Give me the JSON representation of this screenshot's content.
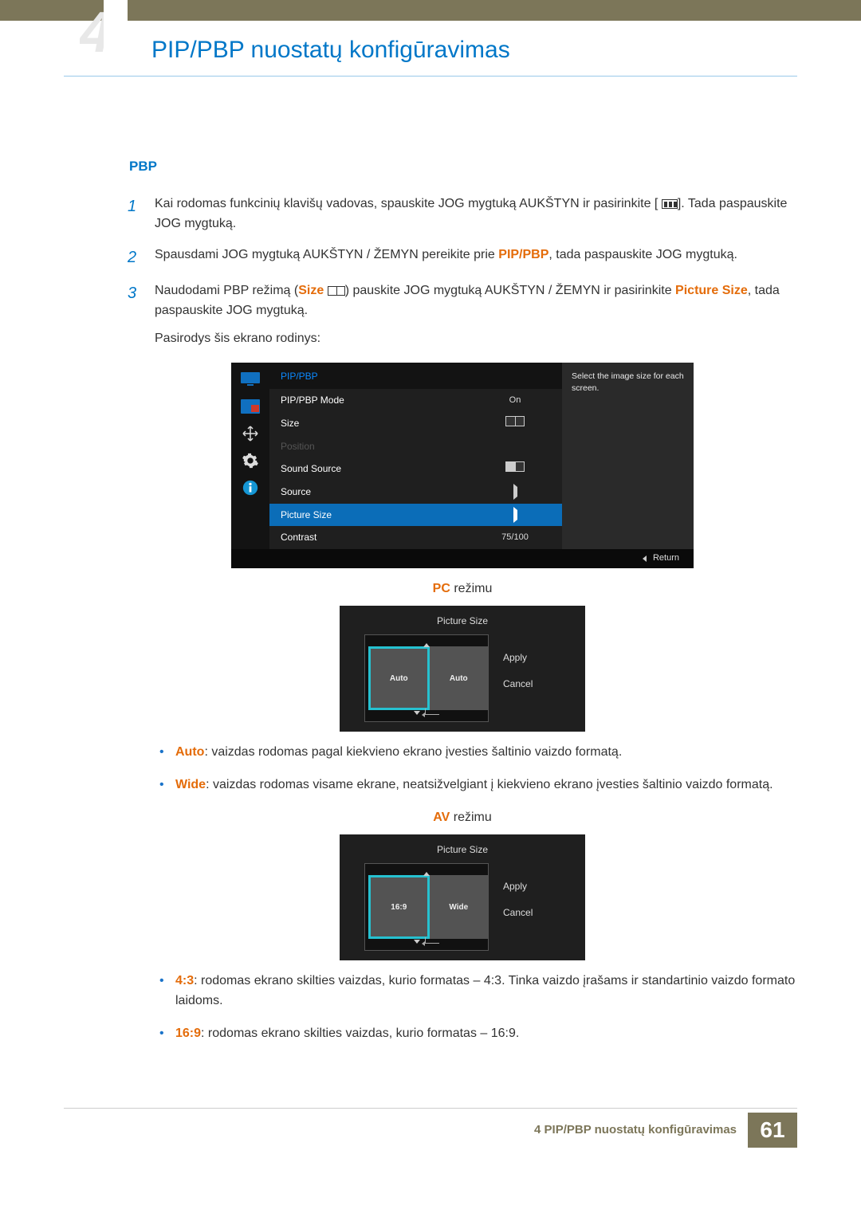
{
  "header": {
    "title": "PIP/PBP nuostatų konfigūravimas"
  },
  "section": {
    "title": "PBP"
  },
  "steps": {
    "s1": {
      "part1": "Kai rodomas funkcinių klavišų vadovas, spauskite JOG mygtuką AUKŠTYN ir pasirinkite [",
      "part2": "]. Tada paspauskite JOG mygtuką."
    },
    "s2": {
      "pre": "Spausdami JOG mygtuką AUKŠTYN / ŽEMYN pereikite prie ",
      "hl": "PIP/PBP",
      "post": ", tada paspauskite JOG mygtuką."
    },
    "s3": {
      "pre": "Naudodami PBP režimą (",
      "sizeLabel": "Size",
      "mid": ") pauskite JOG mygtuką AUKŠTYN / ŽEMYN ir pasirinkite ",
      "hl2": "Picture Size",
      "post": ", tada paspauskite JOG mygtuką.",
      "caption": "Pasirodys šis ekrano rodinys:"
    }
  },
  "osd1": {
    "title": "PIP/PBP",
    "rows": {
      "mode": {
        "label": "PIP/PBP Mode",
        "val": "On"
      },
      "size": {
        "label": "Size"
      },
      "position": {
        "label": "Position"
      },
      "sound": {
        "label": "Sound Source"
      },
      "source": {
        "label": "Source"
      },
      "picture": {
        "label": "Picture Size"
      },
      "contrast": {
        "label": "Contrast",
        "val": "75/100"
      }
    },
    "tip": "Select the image size for each screen.",
    "return": "Return"
  },
  "pcMode": {
    "labelHl": "PC",
    "labelRest": " režimu",
    "osdTitle": "Picture Size",
    "left": "Auto",
    "right": "Auto",
    "apply": "Apply",
    "cancel": "Cancel"
  },
  "pcBullets": {
    "auto": {
      "hl": "Auto",
      "text": ": vaizdas rodomas pagal kiekvieno ekrano įvesties šaltinio vaizdo formatą."
    },
    "wide": {
      "hl": "Wide",
      "text": ": vaizdas rodomas visame ekrane, neatsižvelgiant į kiekvieno ekrano įvesties šaltinio vaizdo formatą."
    }
  },
  "avMode": {
    "labelHl": "AV",
    "labelRest": " režimu",
    "osdTitle": "Picture Size",
    "left": "16:9",
    "right": "Wide",
    "apply": "Apply",
    "cancel": "Cancel"
  },
  "avBullets": {
    "b43": {
      "hl": "4:3",
      "text": ": rodomas ekrano skilties vaizdas, kurio formatas – 4:3. Tinka vaizdo įrašams ir standartinio vaizdo formato laidoms."
    },
    "b169": {
      "hl": "16:9",
      "text": ": rodomas ekrano skilties vaizdas, kurio formatas – 16:9."
    }
  },
  "footer": {
    "chapter": "4 PIP/PBP nuostatų konfigūravimas",
    "page": "61"
  }
}
